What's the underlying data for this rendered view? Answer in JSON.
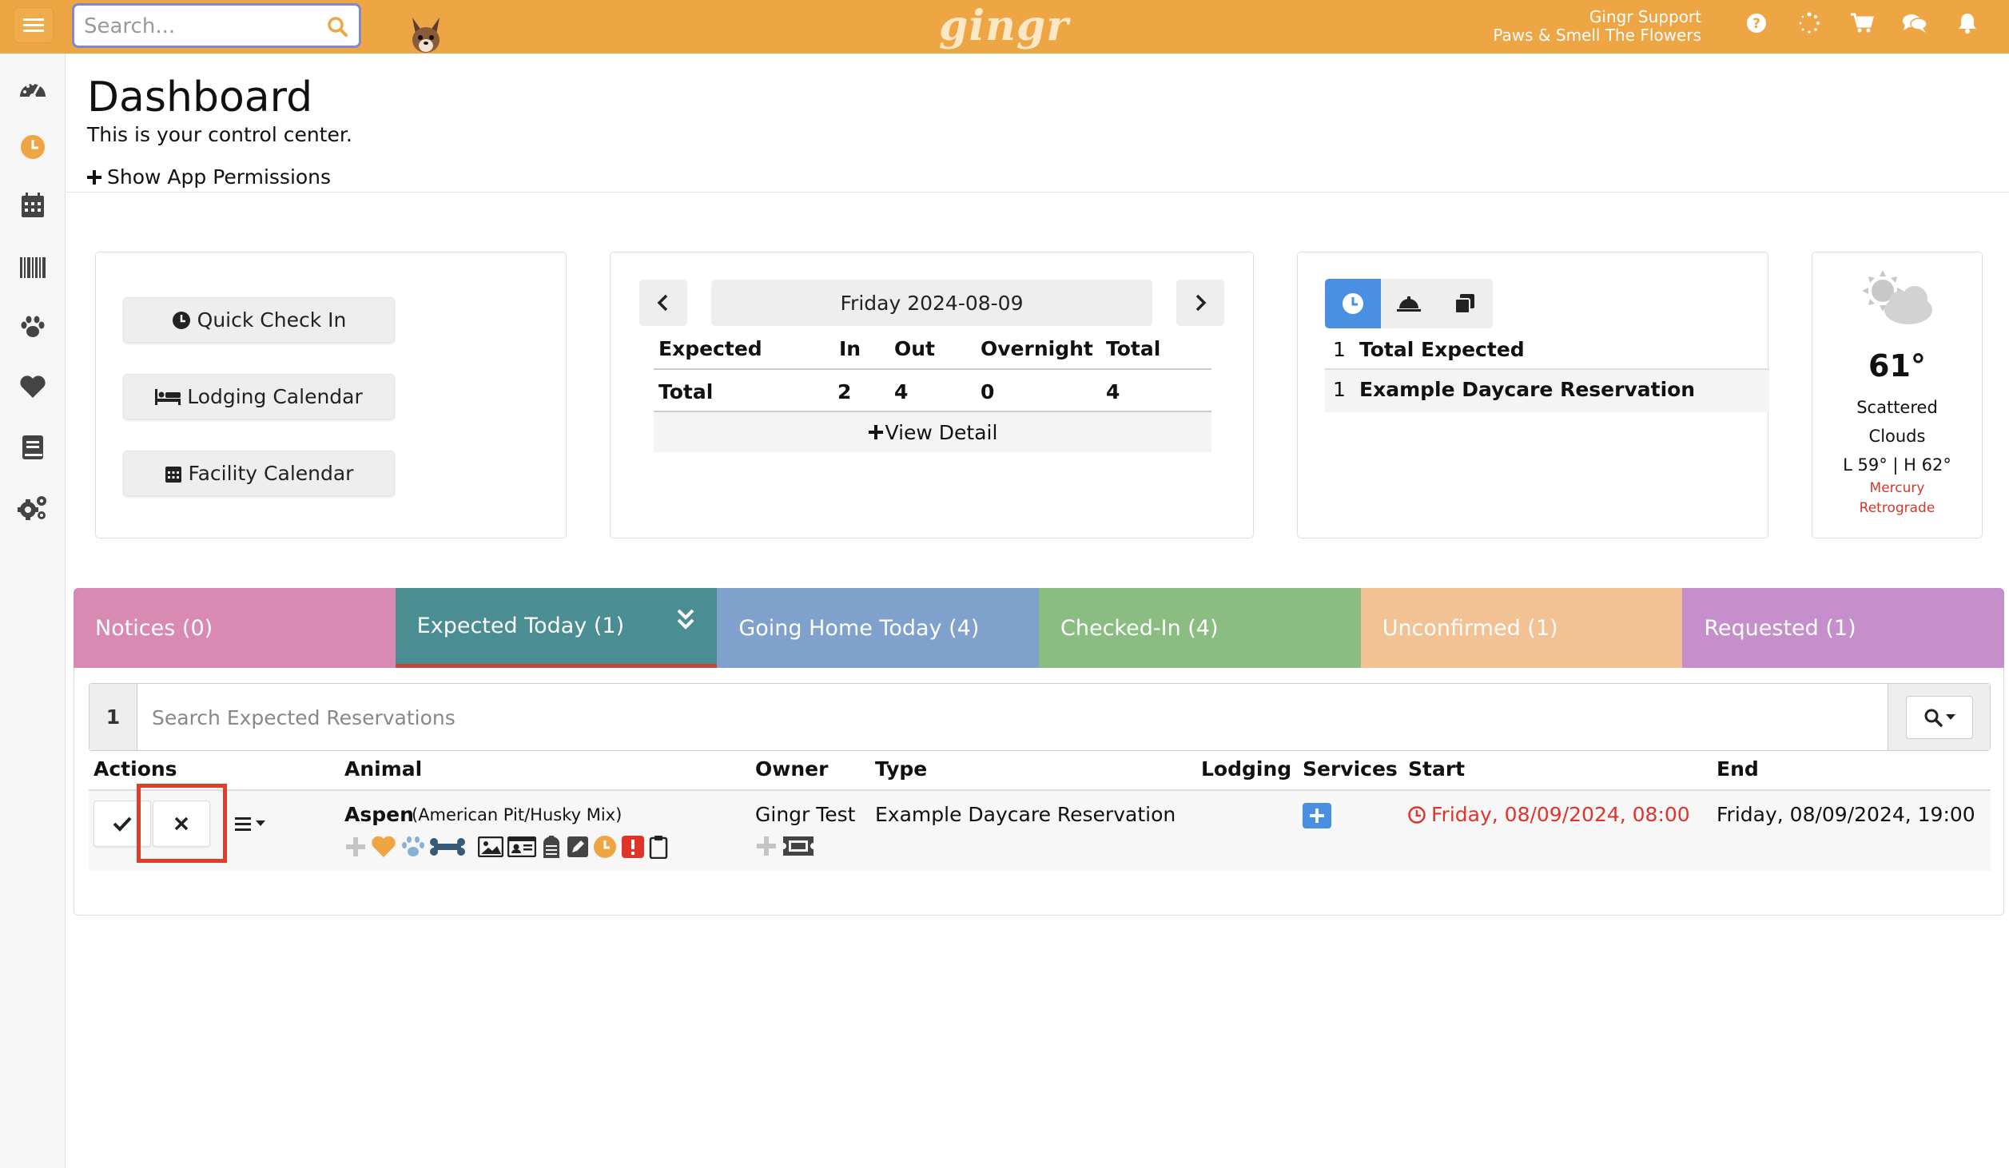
{
  "header": {
    "search_placeholder": "Search...",
    "logo": "gingr",
    "user_name": "Gingr Support",
    "business_name": "Paws & Smell The Flowers",
    "icons": [
      "help-icon",
      "spinner-icon",
      "cart-icon",
      "chat-icon",
      "bell-icon"
    ]
  },
  "sidebar": {
    "icons": [
      "dashboard-icon",
      "clock-icon",
      "calendar-icon",
      "barcode-icon",
      "paw-icon",
      "heart-icon",
      "book-icon",
      "settings-icon"
    ]
  },
  "page": {
    "title": "Dashboard",
    "subtitle": "This is your control center.",
    "permissions_link": "Show App Permissions"
  },
  "quick_actions": {
    "check_in": "Quick Check In",
    "lodging": "Lodging Calendar",
    "facility": "Facility Calendar"
  },
  "counts": {
    "date": "Friday 2024-08-09",
    "headers": [
      "Expected",
      "In",
      "Out",
      "Overnight",
      "Total"
    ],
    "row": {
      "label": "Total",
      "in": "2",
      "out": "4",
      "overnight": "0",
      "total": "4"
    },
    "view_detail": "View Detail"
  },
  "expected_summary": {
    "rows": [
      {
        "count": "1",
        "label": "Total Expected"
      },
      {
        "count": "1",
        "label": "Example Daycare Reservation"
      }
    ]
  },
  "weather": {
    "temp": "61°",
    "condition_line1": "Scattered",
    "condition_line2": "Clouds",
    "range": "L 59° | H 62°",
    "note_line1": "Mercury",
    "note_line2": "Retrograde"
  },
  "tabs": [
    {
      "label": "Notices (0)",
      "color": "#d98ab2"
    },
    {
      "label": "Expected Today (1)",
      "color": "#4a8d92"
    },
    {
      "label": "Going Home Today (4)",
      "color": "#7fa1cc"
    },
    {
      "label": "Checked-In (4)",
      "color": "#8bbd82"
    },
    {
      "label": "Unconfirmed (1)",
      "color": "#f2c294"
    },
    {
      "label": "Requested (1)",
      "color": "#c58fcb"
    }
  ],
  "list": {
    "count": "1",
    "search_placeholder": "Search Expected Reservations",
    "columns": [
      "Actions",
      "Animal",
      "Owner",
      "Type",
      "Lodging",
      "Services",
      "Start",
      "End"
    ],
    "rows": [
      {
        "animal": "Aspen",
        "breed": "(American Pit/Husky Mix)",
        "owner": "Gingr Test",
        "type": "Example Daycare Reservation",
        "lodging": "",
        "start": "Friday, 08/09/2024, 08:00",
        "end": "Friday, 08/09/2024, 19:00"
      }
    ]
  },
  "colors": {
    "brand": "#eea544",
    "accent_blue": "#4a90e2",
    "alert_red": "#e53b2c"
  }
}
